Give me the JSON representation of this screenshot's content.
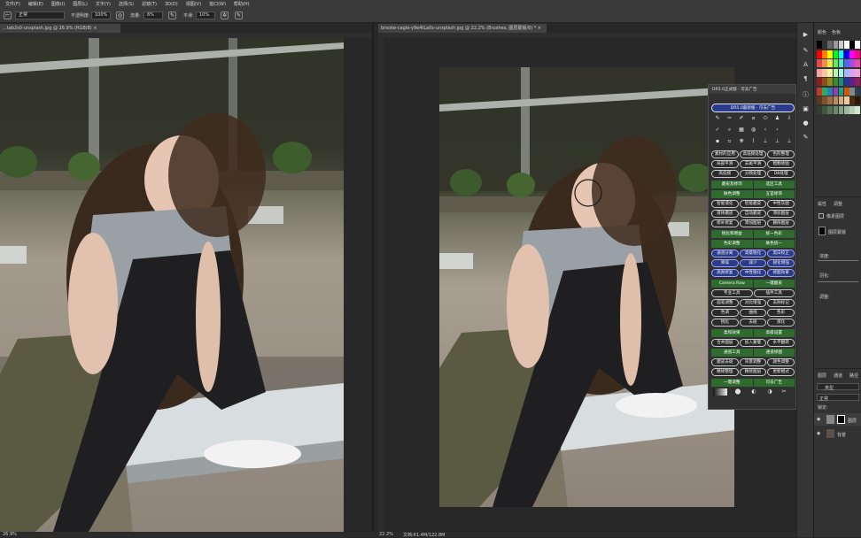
{
  "menu": [
    "文件(F)",
    "编辑(E)",
    "图像(I)",
    "图层(L)",
    "文字(Y)",
    "选择(S)",
    "滤镜(T)",
    "3D(D)",
    "视图(V)",
    "窗口(W)",
    "帮助(H)"
  ],
  "options": {
    "mode_value": "正常",
    "opacity_label": "不透明度:",
    "opacity_value": "100%",
    "flow_label": "流量:",
    "flow_value": "6%",
    "smooth_label": "平滑:",
    "smooth_value": "10%"
  },
  "tabs": {
    "left": "...tab2s0-unsplash.jpg @ 26.9% (RGB/8) ×",
    "right": "brooke-cagle-y9e4tLa0s-unsplash.jpg @ 22.2% (Brushes, 图层蒙版/8) * ×"
  },
  "status": {
    "left_zoom": "26.9%",
    "right_zoom": "22.2%",
    "right_doc": "文档:61.4M/122.8M"
  },
  "right_panel": {
    "swatches_tab": "颜色",
    "swatches_tab2": "色板",
    "props_tab": "属性",
    "adjust_tab": "调整",
    "layer_props_label": "像素图层",
    "layer_mask_label": "图层蒙版",
    "density_label": "浓度:",
    "feather_label": "羽化:",
    "refine_label": "调整:",
    "layers_tab": "图层",
    "channels_tab": "通道",
    "paths_tab": "路径",
    "kind_label": "类型",
    "blend_mode": "正常",
    "lock_label": "锁定:",
    "layer1_name": "图层",
    "layer2_name": "背景"
  },
  "dr5": {
    "title": "DR5.0正式版 · 可去广告",
    "header_button": "DR5.0最新版 · 可去广告",
    "rows": [
      {
        "type": "o",
        "labels": [
          "素材的应用",
          "高低频处理",
          "色阶整理"
        ]
      },
      {
        "type": "o",
        "labels": [
          "局部平滑",
          "去斑平滑",
          "粗颗修图"
        ]
      },
      {
        "type": "o",
        "labels": [
          "高低频",
          "分频处理",
          "DB处理"
        ]
      },
      {
        "type": "g",
        "labels": [
          "磨皮及修饰",
          "选区工具"
        ]
      },
      {
        "type": "g",
        "labels": [
          "肤色调整",
          "五官修饰"
        ]
      },
      {
        "type": "o",
        "labels": [
          "智能液化",
          "智能磨皮",
          "中性灰图"
        ]
      },
      {
        "type": "o",
        "labels": [
          "液体磨皮",
          "自动磨皮",
          "添加图层"
        ]
      },
      {
        "type": "o",
        "labels": [
          "修补修复",
          "添加图层",
          "删除图层"
        ]
      },
      {
        "type": "g",
        "labels": [
          "锐化和增益",
          "统一色彩"
        ]
      },
      {
        "type": "g",
        "labels": [
          "色彩调整",
          "肤色统一"
        ]
      },
      {
        "type": "b",
        "labels": [
          "通道分离",
          "高级锐化",
          "黑白校正"
        ]
      },
      {
        "type": "b",
        "labels": [
          "降噪",
          "减少",
          "锐化增强"
        ]
      },
      {
        "type": "b",
        "labels": [
          "高频修复",
          "中性锐化",
          "修图效果"
        ]
      },
      {
        "type": "g",
        "labels": [
          "Camera Raw",
          "一键磨皮"
        ]
      },
      {
        "type": "o",
        "labels": [
          "专业工具",
          "插件工具"
        ]
      },
      {
        "type": "o",
        "labels": [
          "画笔调整",
          "对比增强",
          "去除标记"
        ]
      },
      {
        "type": "o",
        "labels": [
          "色调",
          "曲线",
          "色彩"
        ]
      },
      {
        "type": "o",
        "labels": [
          "锐化",
          "去斑",
          "液化"
        ]
      },
      {
        "type": "g",
        "labels": [
          "柔和效果",
          "高级设置"
        ]
      },
      {
        "type": "o",
        "labels": [
          "合并图层",
          "加入蒙版",
          "水平翻转"
        ]
      },
      {
        "type": "g",
        "labels": [
          "通道工具",
          "通道修图"
        ]
      },
      {
        "type": "o",
        "labels": [
          "磨皮去斑",
          "背景调整",
          "颜色调整"
        ]
      },
      {
        "type": "o",
        "labels": [
          "精修整理",
          "精修图层",
          "更新模式"
        ]
      },
      {
        "type": "g",
        "labels": [
          "一键调整",
          "可去广告"
        ]
      }
    ]
  }
}
